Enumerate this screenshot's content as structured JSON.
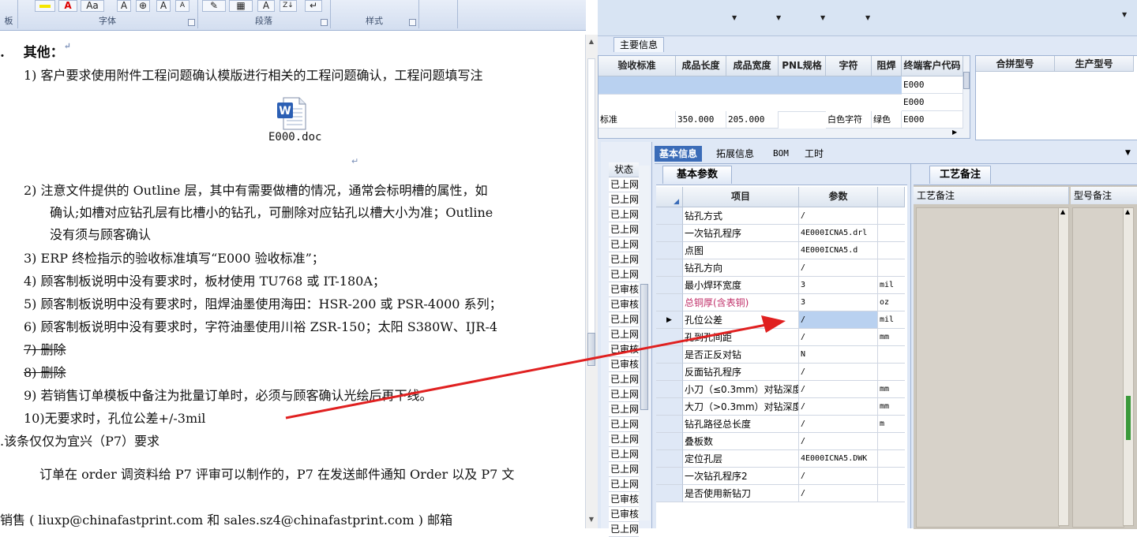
{
  "ribbon": {
    "group_clipboard_label": "板",
    "group_font_label": "字体",
    "group_paragraph_label": "段落",
    "group_styles_label": "样式",
    "font_buttons": [
      "A",
      "Aa",
      "A",
      "⊕",
      "A",
      "A"
    ]
  },
  "document": {
    "heading_other": "其他：",
    "item1": "1)  客户要求使用附件工程问题确认模版进行相关的工程问题确认，工程问题填写注",
    "attachment_name": "E000.doc",
    "item2_line1": "2)  注意文件提供的 Outline 层，其中有需要做槽的情况，通常会标明槽的属性，如",
    "item2_line2": "确认;如槽对应钻孔层有比槽小的钻孔，可删除对应钻孔以槽大小为准；Outline",
    "item2_line3": "没有须与顾客确认",
    "item3": "3)  ERP 终检指示的验收标准填写“E000 验收标准”；",
    "item4": "4)  顾客制板说明中没有要求时，板材使用 TU768 或 IT-180A；",
    "item5": "5)  顾客制板说明中没有要求时，阻焊油墨使用海田：HSR-200 或 PSR-4000 系列；",
    "item6": "6)  顾客制板说明中没有要求时，字符油墨使用川裕 ZSR-150；太阳 S380W、IJR-4",
    "item7": "7)  删除",
    "item8": "8)  删除",
    "item9": "9) 若销售订单模板中备注为批量订单时，必须与顾客确认光绘后再下线。",
    "item10": "10)无要求时，孔位公差+/-3mil",
    "note_p7": ".该条仅仅为宜兴（P7）要求",
    "order_line": "订单在 order 调资料给 P7 评审可以制作的，P7 在发送邮件通知 Order 以及 P7 文",
    "email_line": "销售 ( liuxp@chinafastprint.com 和 sales.sz4@chinafastprint.com ) 邮箱"
  },
  "erp": {
    "main_info_tab": "主要信息",
    "top_grid": {
      "columns": [
        "验收标准",
        "成品长度",
        "成品宽度",
        "PNL规格",
        "字符",
        "阻焊",
        "终端客户代码"
      ],
      "rows": [
        [
          "",
          "",
          "",
          "",
          "",
          "",
          "E000"
        ],
        [
          "",
          "",
          "",
          "",
          "",
          "",
          "E000"
        ],
        [
          "标准",
          "350.000",
          "205.000",
          "",
          "白色字符",
          "绿色",
          "E000"
        ]
      ]
    },
    "side_grid_columns": [
      "合拼型号",
      "生产型号"
    ],
    "detail_tabs": [
      "基本信息",
      "拓展信息",
      "BOM",
      "工时"
    ],
    "status_header": "状态",
    "status_items": [
      "已上网",
      "已上网",
      "已上网",
      "已上网",
      "已上网",
      "已上网",
      "已上网",
      "已审核",
      "已审核",
      "已上网",
      "已上网",
      "已审核",
      "已审核",
      "已上网",
      "已上网",
      "已上网",
      "已上网",
      "已上网",
      "已上网",
      "已上网",
      "已上网",
      "已审核",
      "已审核",
      "已上网"
    ],
    "basic_params_tab": "基本参数",
    "param_columns": [
      "项目",
      "参数"
    ],
    "params": [
      {
        "item": "钻孔方式",
        "value": "/",
        "unit": ""
      },
      {
        "item": "一次钻孔程序",
        "value": "4E000ICNA5.drl",
        "unit": ""
      },
      {
        "item": "点图",
        "value": "4E000ICNA5.d",
        "unit": ""
      },
      {
        "item": "钻孔方向",
        "value": "/",
        "unit": ""
      },
      {
        "item": "最小焊环宽度",
        "value": "3",
        "unit": "mil"
      },
      {
        "item": "总铜厚(含表铜)",
        "value": "3",
        "unit": "oz"
      },
      {
        "item": "孔位公差",
        "value": "/",
        "unit": "mil"
      },
      {
        "item": "孔到孔间距",
        "value": "/",
        "unit": "mm"
      },
      {
        "item": "是否正反对钻",
        "value": "N",
        "unit": ""
      },
      {
        "item": "反面钻孔程序",
        "value": "/",
        "unit": ""
      },
      {
        "item": "小刀（≤0.3mm）对钻深度",
        "value": "/",
        "unit": "mm"
      },
      {
        "item": "大刀（>0.3mm）对钻深度",
        "value": "/",
        "unit": "mm"
      },
      {
        "item": "钻孔路径总长度",
        "value": "/",
        "unit": "m"
      },
      {
        "item": "叠板数",
        "value": "/",
        "unit": ""
      },
      {
        "item": "定位孔层",
        "value": "4E000ICNA5.DWK",
        "unit": ""
      },
      {
        "item": "一次钻孔程序2",
        "value": "/",
        "unit": ""
      },
      {
        "item": "是否使用新钻刀",
        "value": "/",
        "unit": ""
      }
    ],
    "process_notes_tab": "工艺备注",
    "process_notes_columns": [
      "工艺备注",
      "型号备注"
    ],
    "colors": {
      "highlight_row": "#b9d1f0",
      "red_item": "#c0306a",
      "arrow": "#e02020"
    }
  }
}
